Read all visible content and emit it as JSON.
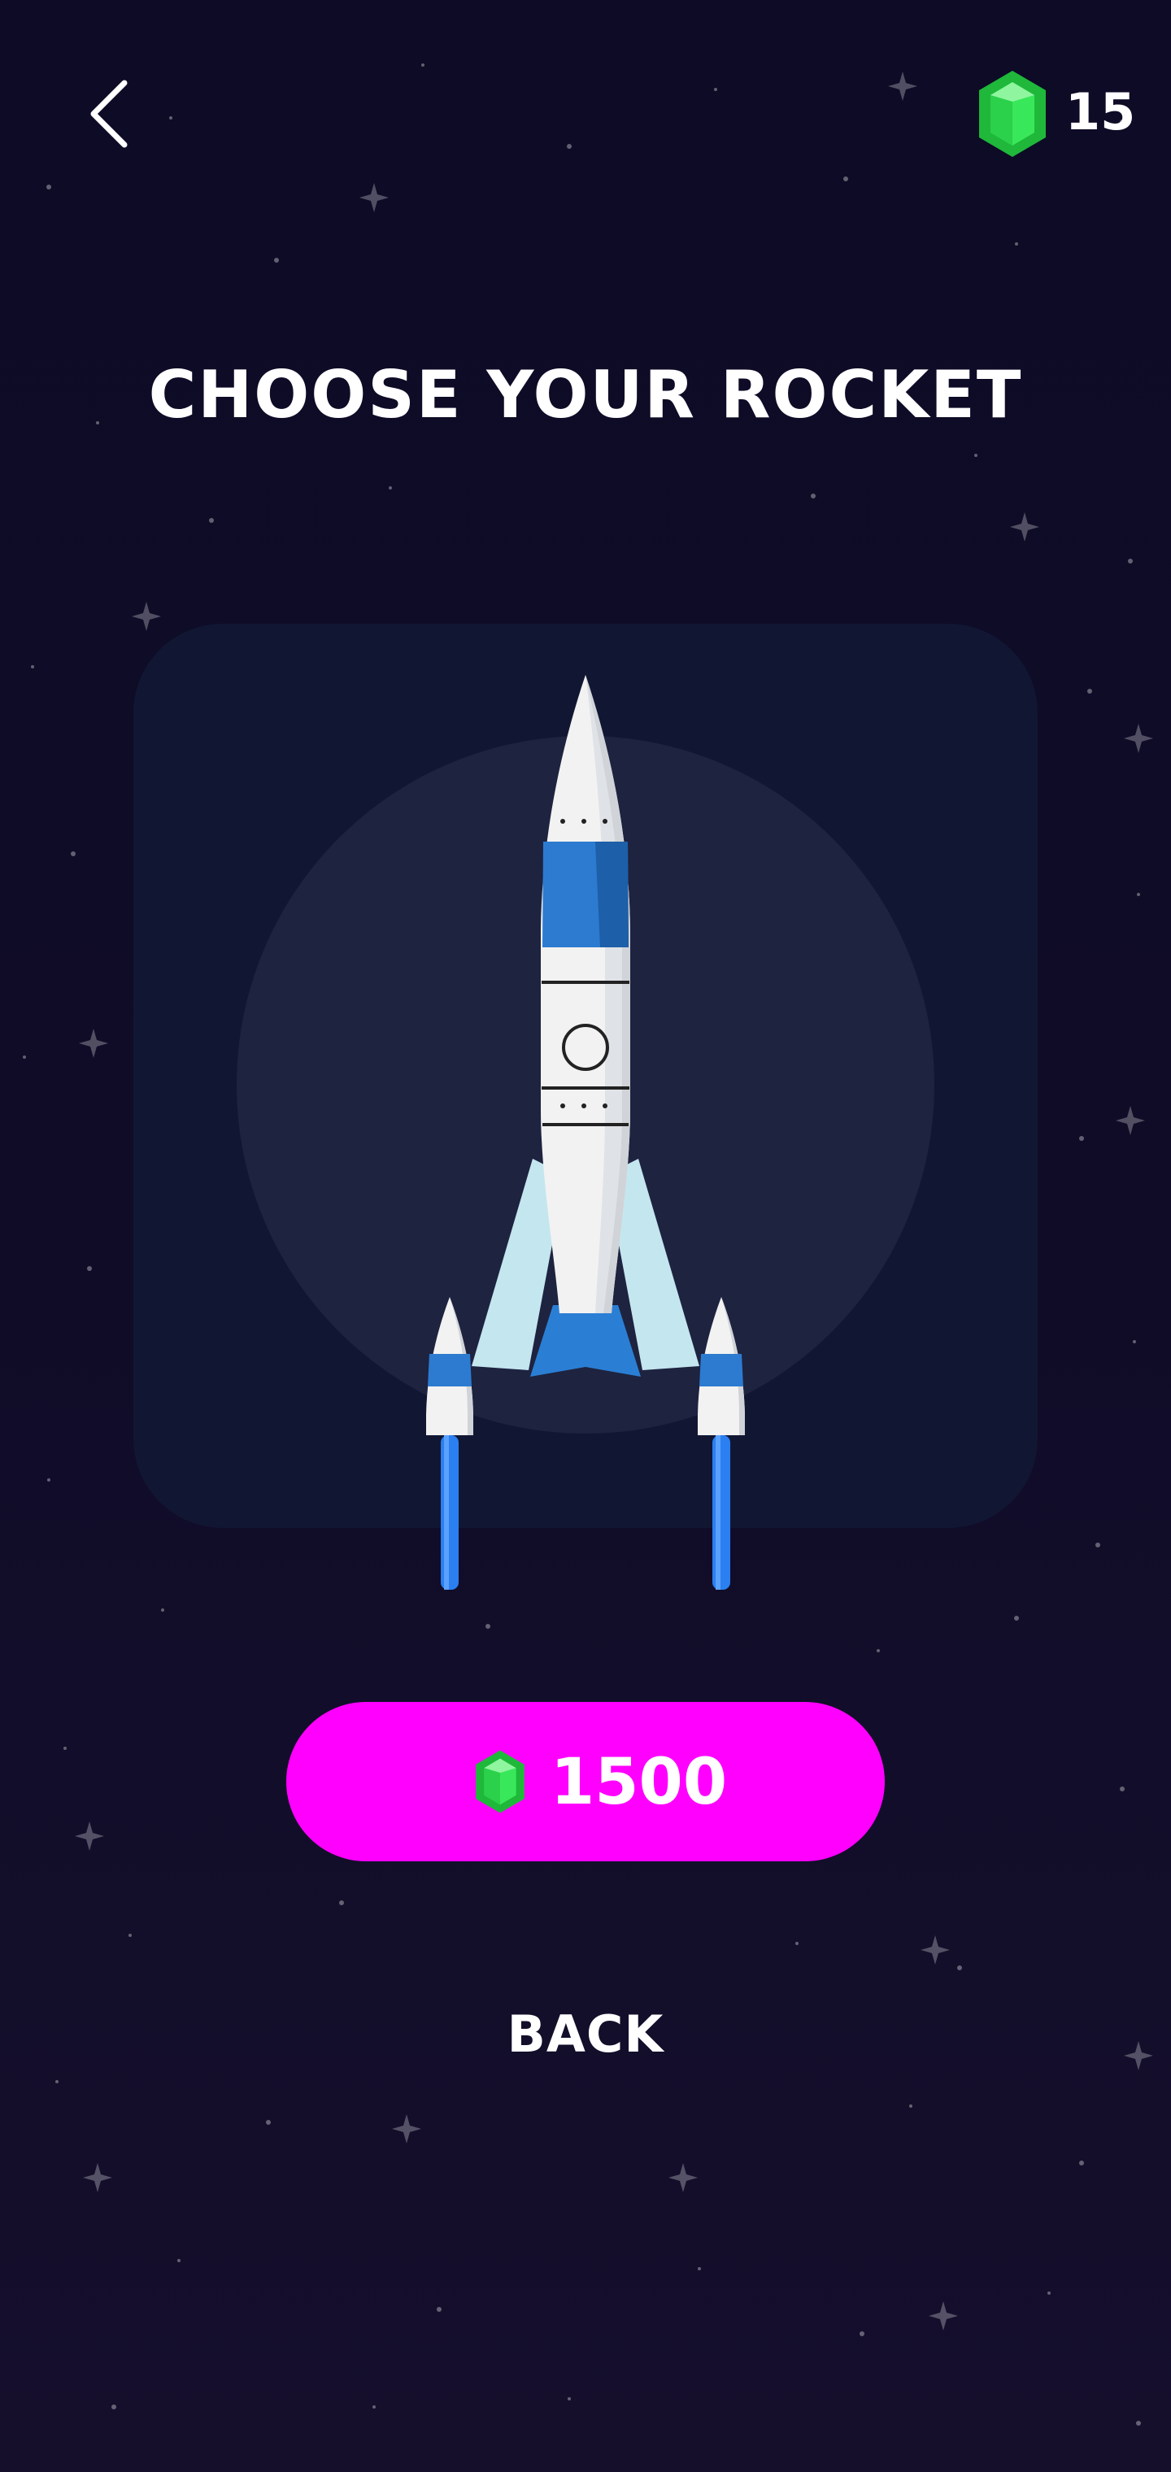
{
  "header": {
    "back_icon": "chevron-left-icon",
    "gem_icon": "green-gem-icon",
    "gem_count": "15"
  },
  "screen": {
    "title": "CHOOSE YOUR ROCKET",
    "rocket": "blue-white-rocket"
  },
  "purchase": {
    "price": "1500",
    "button_color": "#ff00ff",
    "gem_color": "#22d84a"
  },
  "footer": {
    "back_label": "BACK"
  }
}
